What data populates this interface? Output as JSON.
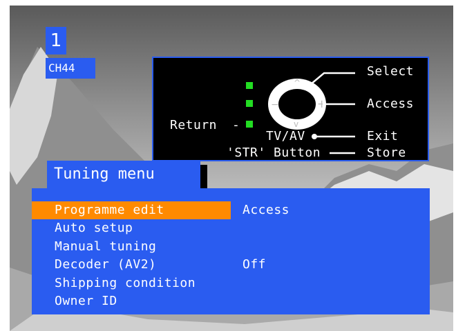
{
  "channel": {
    "number": "1",
    "name": "CH44"
  },
  "help": {
    "select": "Select",
    "access": "Access",
    "return": "Return",
    "tvav": "TV/AV",
    "exit": "Exit",
    "str_button": "'STR' Button",
    "store": "Store",
    "indicator_color": "#22dd22"
  },
  "menu": {
    "title": "Tuning menu",
    "items": [
      {
        "label": "Programme edit",
        "value": "Access",
        "selected": true
      },
      {
        "label": "Auto setup",
        "value": ""
      },
      {
        "label": "Manual tuning",
        "value": ""
      },
      {
        "label": "Decoder (AV2)",
        "value": "Off"
      },
      {
        "label": "Shipping condition",
        "value": ""
      },
      {
        "label": "Owner ID",
        "value": ""
      }
    ]
  },
  "colors": {
    "panel": "#2a5cf0",
    "highlight": "#ff8a00",
    "text": "#ffffff"
  }
}
